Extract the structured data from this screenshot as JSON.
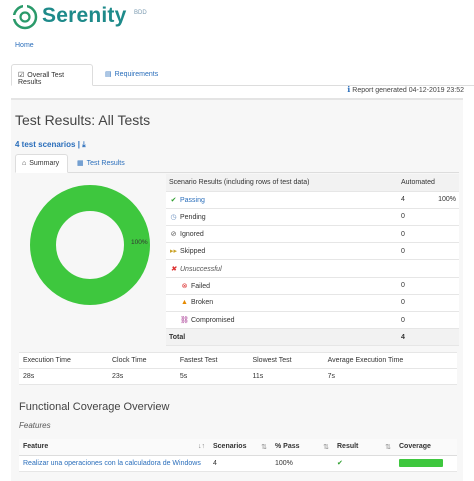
{
  "brand": {
    "name": "Serenity",
    "suffix": "BDD"
  },
  "breadcrumb": "Home",
  "top_tabs": [
    {
      "label": "Overall Test Results",
      "icon": "checkbox-icon",
      "active": true
    },
    {
      "label": "Requirements",
      "icon": "book-icon",
      "active": false
    }
  ],
  "report_generated": "Report generated 04-12-2019 23:52",
  "page_title": "Test Results: All Tests",
  "scenario_count": "4 test scenarios",
  "sub_tabs": [
    {
      "label": "Summary",
      "icon": "home-icon",
      "active": true
    },
    {
      "label": "Test Results",
      "icon": "chart-icon",
      "active": false
    }
  ],
  "chart_data": {
    "type": "pie",
    "labels": [
      "Passing"
    ],
    "values": [
      100
    ],
    "value_label": "100%",
    "colors": [
      "#3ec73e"
    ]
  },
  "results": {
    "header": {
      "label": "Scenario Results (including rows of test data)",
      "col": "Automated"
    },
    "rows": [
      {
        "label": "Passing",
        "count": "4",
        "pct": "100%",
        "icon": "check-circle-icon",
        "color": "#2e9e2e",
        "link": true
      },
      {
        "label": "Pending",
        "count": "0",
        "pct": "",
        "icon": "clock-icon",
        "color": "#6a8fbf",
        "link": false
      },
      {
        "label": "Ignored",
        "count": "0",
        "pct": "",
        "icon": "ban-icon",
        "color": "#555555",
        "link": false
      },
      {
        "label": "Skipped",
        "count": "0",
        "pct": "",
        "icon": "skip-icon",
        "color": "#c9a227",
        "link": false
      },
      {
        "label": "Unsuccessful",
        "count": "",
        "pct": "",
        "icon": "times-icon",
        "color": "#d33",
        "link": false
      },
      {
        "label": "Failed",
        "count": "0",
        "pct": "",
        "icon": "times-circle-icon",
        "color": "#d33",
        "link": false
      },
      {
        "label": "Broken",
        "count": "0",
        "pct": "",
        "icon": "warning-icon",
        "color": "#e68a00",
        "link": false
      },
      {
        "label": "Compromised",
        "count": "0",
        "pct": "",
        "icon": "chain-broken-icon",
        "color": "#a0288a",
        "link": false
      }
    ],
    "total": {
      "label": "Total",
      "count": "4"
    }
  },
  "stats": {
    "headers": [
      "Execution Time",
      "Clock Time",
      "Fastest Test",
      "Slowest Test",
      "Average Execution Time"
    ],
    "values": [
      "28s",
      "23s",
      "5s",
      "11s",
      "7s"
    ]
  },
  "functional_coverage_title": "Functional Coverage Overview",
  "features_title": "Features",
  "feature_table": {
    "headers": [
      "Feature",
      "Scenarios",
      "% Pass",
      "Result",
      "Coverage"
    ],
    "rows": [
      {
        "feature": "Realizar una operaciones con la calculadora de Windows",
        "scenarios": "4",
        "pass": "100%",
        "coverage": 100
      }
    ]
  }
}
